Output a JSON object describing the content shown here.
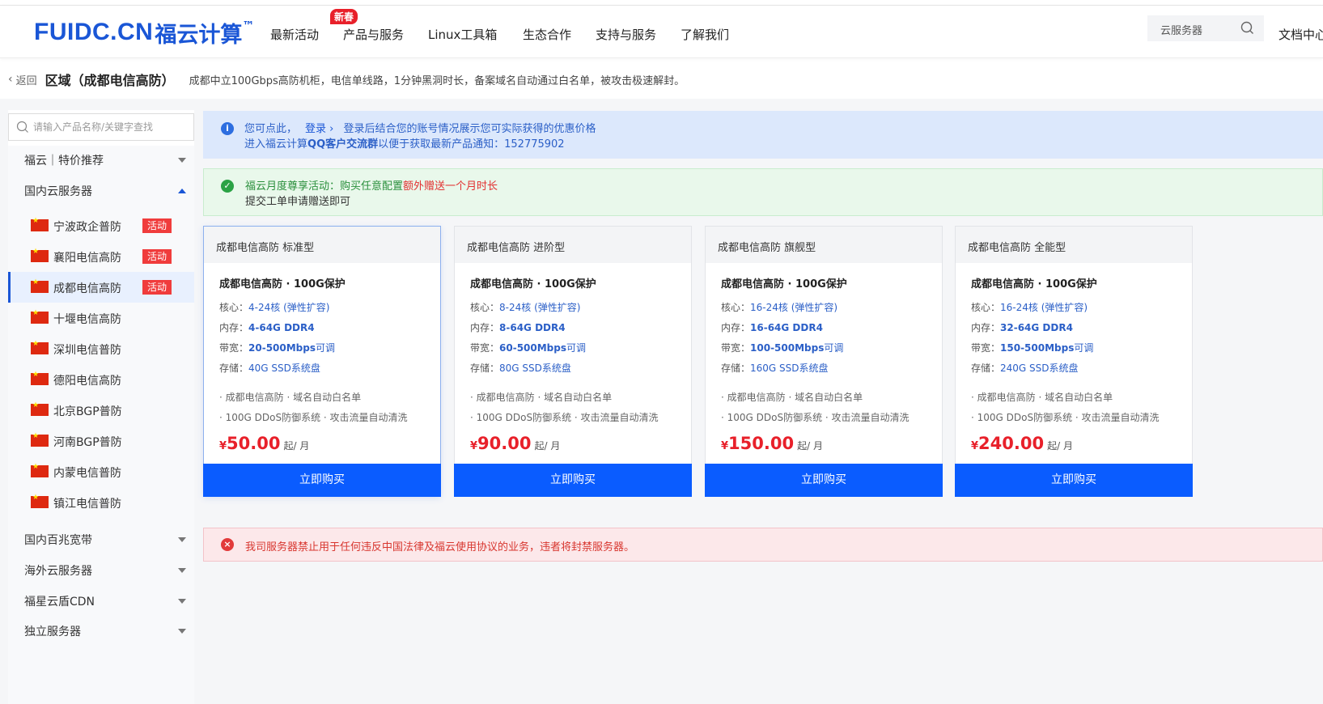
{
  "header": {
    "logo_en": "FUIDC.CN",
    "logo_cn": "福云计算",
    "logo_tm": "™",
    "badge": "新春",
    "nav": [
      "最新活动",
      "产品与服务",
      "Linux工具箱",
      "生态合作",
      "支持与服务",
      "了解我们"
    ],
    "search_text": "云服务器",
    "doc_center": "文档中心"
  },
  "breadcrumb": {
    "back": "返回",
    "region": "区域（成都电信高防）",
    "desc": "成都中立100Gbps高防机柜，电信单线路，1分钟黑洞时长，备案域名自动通过白名单，被攻击极速解封。"
  },
  "sidebar": {
    "search_placeholder": "请输入产品名称/关键字查找",
    "categories": [
      {
        "label": "福云｜特价推荐"
      },
      {
        "label": "国内云服务器"
      },
      {
        "label": "国内百兆宽带"
      },
      {
        "label": "海外云服务器"
      },
      {
        "label": "福星云盾CDN"
      },
      {
        "label": "独立服务器"
      }
    ],
    "sub_items": [
      {
        "label": "宁波政企普防",
        "tag": "活动"
      },
      {
        "label": "襄阳电信高防",
        "tag": "活动"
      },
      {
        "label": "成都电信高防",
        "tag": "活动"
      },
      {
        "label": "十堰电信高防",
        "tag": ""
      },
      {
        "label": "深圳电信普防",
        "tag": ""
      },
      {
        "label": "德阳电信高防",
        "tag": ""
      },
      {
        "label": "北京BGP普防",
        "tag": ""
      },
      {
        "label": "河南BGP普防",
        "tag": ""
      },
      {
        "label": "内蒙电信普防",
        "tag": ""
      },
      {
        "label": "镇江电信普防",
        "tag": ""
      }
    ]
  },
  "notices": {
    "blue": {
      "line1_prefix": "您可点此，",
      "login": "登录 ›",
      "line1_suffix": "登录后结合您的账号情况展示您可实际获得的优惠价格",
      "line2_prefix": "进入福云计算",
      "line2_bold": "QQ客户交流群",
      "line2_suffix": "以便于获取最新产品通知：152775902"
    },
    "green": {
      "line1_prefix": "福云月度尊享活动：购买任意配置",
      "line1_emph": "额外赠送一个月时长",
      "line2": "提交工单申请赠送即可"
    },
    "red": {
      "text": "我司服务器禁止用于任何违反中国法律及福云使用协议的业务，违者将封禁服务器。"
    }
  },
  "cards": [
    {
      "title": "成都电信高防 标准型",
      "subtitle": "成都电信高防 · 100G保护",
      "core_label": "核心：",
      "core_value": "4-24核",
      "core_note": "(弹性扩容)",
      "mem_label": "内存：",
      "mem_value": "4-64G DDR4",
      "bw_label": "带宽：",
      "bw_value": "20-500Mbps",
      "bw_note": "可调",
      "disk_label": "存储：",
      "disk_value": "40G SSD系统盘",
      "feature1": "· 成都电信高防 · 域名自动白名单",
      "feature2": "· 100G DDoS防御系统 · 攻击流量自动清洗",
      "currency": "¥",
      "price": "50.00",
      "unit": "起/ 月",
      "buy": "立即购买"
    },
    {
      "title": "成都电信高防 进阶型",
      "subtitle": "成都电信高防 · 100G保护",
      "core_label": "核心：",
      "core_value": "8-24核",
      "core_note": "(弹性扩容)",
      "mem_label": "内存：",
      "mem_value": "8-64G DDR4",
      "bw_label": "带宽：",
      "bw_value": "60-500Mbps",
      "bw_note": "可调",
      "disk_label": "存储：",
      "disk_value": "80G SSD系统盘",
      "feature1": "· 成都电信高防 · 域名自动白名单",
      "feature2": "· 100G DDoS防御系统 · 攻击流量自动清洗",
      "currency": "¥",
      "price": "90.00",
      "unit": "起/ 月",
      "buy": "立即购买"
    },
    {
      "title": "成都电信高防 旗舰型",
      "subtitle": "成都电信高防 · 100G保护",
      "core_label": "核心：",
      "core_value": "16-24核",
      "core_note": "(弹性扩容)",
      "mem_label": "内存：",
      "mem_value": "16-64G DDR4",
      "bw_label": "带宽：",
      "bw_value": "100-500Mbps",
      "bw_note": "可调",
      "disk_label": "存储：",
      "disk_value": "160G SSD系统盘",
      "feature1": "· 成都电信高防 · 域名自动白名单",
      "feature2": "· 100G DDoS防御系统 · 攻击流量自动清洗",
      "currency": "¥",
      "price": "150.00",
      "unit": "起/ 月",
      "buy": "立即购买"
    },
    {
      "title": "成都电信高防 全能型",
      "subtitle": "成都电信高防 · 100G保护",
      "core_label": "核心：",
      "core_value": "16-24核",
      "core_note": "(弹性扩容)",
      "mem_label": "内存：",
      "mem_value": "32-64G DDR4",
      "bw_label": "带宽：",
      "bw_value": "150-500Mbps",
      "bw_note": "可调",
      "disk_label": "存储：",
      "disk_value": "240G SSD系统盘",
      "feature1": "· 成都电信高防 · 域名自动白名单",
      "feature2": "· 100G DDoS防御系统 · 攻击流量自动清洗",
      "currency": "¥",
      "price": "240.00",
      "unit": "起/ 月",
      "buy": "立即购买"
    }
  ],
  "colors": {
    "brand": "#1a56d6",
    "buy_button": "#0a5cff",
    "price": "#e8202a",
    "tag": "#f03c3c"
  },
  "icons": {
    "search": "search-icon",
    "info": "info-icon",
    "success": "check-circle-icon",
    "error": "close-circle-icon",
    "flag": "china-flag-icon"
  }
}
